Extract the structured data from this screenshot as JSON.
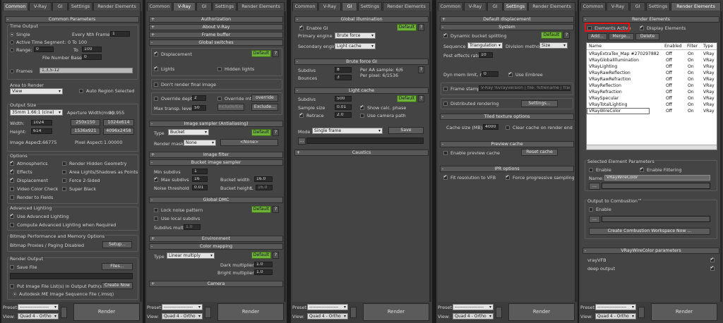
{
  "tabs": {
    "common": "Common",
    "vray": "V-Ray",
    "gi": "GI",
    "settings": "Settings",
    "render_elements": "Render Elements"
  },
  "preset_label": "Preset:",
  "view_label": "View:",
  "preset_value": "-------------------",
  "view_value": "Quad 4 - Ortho",
  "render_label": "Render",
  "p1": {
    "common_params": "Common Parameters",
    "time_output": "Time Output",
    "single": "Single",
    "every_nth": "Every Nth Frame:",
    "every_nth_val": "1",
    "active_seg": "Active Time Segment:",
    "active_seg_range": "0 To 100",
    "range": "Range:",
    "range_from": "0",
    "range_to": "To",
    "range_end": "100",
    "file_number_base": "File Number Base:",
    "file_number_val": "0",
    "frames": "Frames",
    "frames_val": "1,3,5-12",
    "area_to_render": "Area to Render",
    "area_dd": "View",
    "auto_region": "Auto Region Selected",
    "output_size": "Output Size",
    "size_dd": "35mm 1.66:1 (cine)",
    "aperture": "Aperture Width(mm):",
    "aperture_val": "20.955",
    "width": "Width:",
    "width_val": "1024",
    "height": "Height:",
    "height_val": "614",
    "preset_a": "250x150",
    "preset_b": "1024x614",
    "preset_c": "1536x921",
    "preset_d": "4096x2458",
    "image_aspect": "Image Aspect:",
    "image_aspect_val": "1.66775",
    "pixel_aspect": "Pixel Aspect:",
    "pixel_aspect_val": "1.00000",
    "options": "Options",
    "atmospherics": "Atmospherics",
    "render_hidden": "Render Hidden Geometry",
    "effects": "Effects",
    "area_lights": "Area Lights/Shadows as Points",
    "displacement": "Displacement",
    "force_2sided": "Force 2-Sided",
    "video_color": "Video Color Check",
    "super_black": "Super Black",
    "render_fields": "Render to Fields",
    "adv_lighting": "Advanced Lighting",
    "use_adv": "Use Advanced Lighting",
    "compute_adv": "Compute Advanced Lighting when Required",
    "bitmap_perf": "Bitmap Performance and Memory Options",
    "bitmap_proxies": "Bitmap Proxies / Paging Disabled",
    "setup": "Setup...",
    "render_output": "Render Output",
    "save_file": "Save File",
    "files": "Files...",
    "put_image": "Put Image File List(s) in Output Path(s)",
    "create_now": "Create Now",
    "autodesk": "Autodesk ME Image Sequence File (.imsq)"
  },
  "p2": {
    "authorization": "Authorization",
    "about": "About V-Ray",
    "frame_buffer": "Frame buffer",
    "global_switches": "Global switches",
    "displacement": "Displacement",
    "default": "Default",
    "q": "?",
    "lights": "Lights",
    "hidden_lights": "Hidden lights",
    "dont_render": "Don't render final image",
    "override_depth": "Override depth",
    "override_depth_val": "2",
    "override_mtl": "Override mtl",
    "override": "override",
    "max_transp": "Max transp. levels",
    "max_transp_val": "50",
    "include_exc": "Include/Exc",
    "exclude": "Exclude...",
    "image_sampler": "Image sampler (Antialiasing)",
    "type": "Type",
    "type_val": "Bucket",
    "render_mask": "Render mask",
    "render_mask_val": "None",
    "none_btn": "<None>",
    "image_filter": "Image filter",
    "bucket_sampler": "Bucket image sampler",
    "min_subdivs": "Min subdivs",
    "min_subdivs_val": "1",
    "max_subdivs": "Max subdivs",
    "max_subdivs_val": "16",
    "bucket_width": "Bucket width",
    "bucket_width_val": "16.0",
    "noise_thresh": "Noise threshold",
    "noise_thresh_val": "0.01",
    "bucket_height": "Bucket height",
    "bucket_l": "L",
    "bucket_height_val": "16.0",
    "global_dmc": "Global DMC",
    "lock_noise": "Lock noise pattern",
    "use_local": "Use local subdivs",
    "subdivs_mult": "Subdivs mult.",
    "subdivs_mult_val": "1.0",
    "environment": "Environment",
    "color_mapping": "Color mapping",
    "cm_type_val": "Linear multiply",
    "dark_mult": "Dark multiplier:",
    "dark_mult_val": "1.0",
    "bright_mult": "Bright multiplier:",
    "bright_mult_val": "1.0",
    "camera": "Camera"
  },
  "p3": {
    "gi": "Global illumination",
    "enable_gi": "Enable GI",
    "default": "Default",
    "q": "?",
    "primary": "Primary engine",
    "primary_val": "Brute force",
    "secondary": "Secondary engine",
    "secondary_val": "Light cache",
    "brute_gi": "Brute force GI",
    "subdivs": "Subdivs",
    "subdivs_val": "8",
    "per_aa": "Per AA sample: 6/6",
    "bounces": "Bounces",
    "bounces_val": "3",
    "per_pixel": "Per pixel: 6/1536",
    "light_cache": "Light cache",
    "lc_subdivs_val": "500",
    "sample_size": "Sample size",
    "sample_size_val": "0.01",
    "show_calc": "Show calc. phase",
    "retrace": "Retrace",
    "retrace_val": "2.0",
    "use_cam": "Use camera path",
    "mode": "Mode",
    "mode_val": "Single frame",
    "save": "Save",
    "dots": "...",
    "caustics": "Caustics"
  },
  "p4": {
    "default_disp": "Default displacement",
    "system": "System",
    "dyn_bucket": "Dynamic bucket splitting",
    "default": "Default",
    "q": "?",
    "sequence": "Sequence",
    "sequence_val": "Triangulation",
    "div_method": "Division method",
    "div_val": "Size",
    "post_effects": "Post effects rate",
    "post_effects_val": "10",
    "dyn_mem": "Dyn mem limit, mb",
    "dyn_mem_val": "0",
    "use_embree": "Use Embree",
    "frame_stamp": "Frame stamp",
    "stamp_val": "V-Ray %vrayversion | file: %filename | fram",
    "distributed": "Distributed rendering",
    "settings_btn": "Settings...",
    "tiled": "Tiled texture options",
    "cache_size": "Cache size (MB):",
    "cache_val": "4000",
    "clear_cache": "Clear cache on render end",
    "preview_cache": "Preview cache",
    "enable_preview": "Enable preview cache",
    "reset_cache": "Reset cache",
    "ipr": "IPR options",
    "fit_vfb": "Fit resolution to VFB",
    "force_prog": "Force progressive sampling"
  },
  "p5": {
    "render_elements": "Render Elements",
    "elements_active": "Elements Active",
    "display_elements": "Display Elements",
    "add": "Add...",
    "merge": "Merge...",
    "delete": "Delete",
    "col_name": "Name",
    "col_enabled": "Enabled",
    "col_filter": "Filter",
    "col_type": "Type",
    "rows": [
      {
        "name": "VRayExtraTex_Map #270297882",
        "enabled": "Off",
        "filter": "On",
        "type": "VRay"
      },
      {
        "name": "VRayGlobalIllumination",
        "enabled": "Off",
        "filter": "On",
        "type": "VRay"
      },
      {
        "name": "VRayLighting",
        "enabled": "Off",
        "filter": "On",
        "type": "VRay"
      },
      {
        "name": "VRayRawReflection",
        "enabled": "Off",
        "filter": "On",
        "type": "VRay"
      },
      {
        "name": "VRayRawRefraction",
        "enabled": "Off",
        "filter": "On",
        "type": "VRay"
      },
      {
        "name": "VRayReflection",
        "enabled": "Off",
        "filter": "On",
        "type": "VRay"
      },
      {
        "name": "VRayRefraction",
        "enabled": "Off",
        "filter": "On",
        "type": "VRay"
      },
      {
        "name": "VRaySpecular",
        "enabled": "Off",
        "filter": "On",
        "type": "VRay"
      },
      {
        "name": "VRayTotalLighting",
        "enabled": "Off",
        "filter": "On",
        "type": "VRay"
      },
      {
        "name": "VRayWireColor",
        "enabled": "Off",
        "filter": "On",
        "type": "VRay"
      }
    ],
    "selected_params": "Selected Element Parameters",
    "enable": "Enable",
    "enable_filtering": "Enable Filtering",
    "name_label": "Name:",
    "name_val": "VRayWireColor",
    "dots": "...",
    "output_comb": "Output to Combustion™",
    "create_ws": "Create Combustion Workspace Now ...",
    "wire_params": "VRayWireColor parameters",
    "vrayvfb": "vrayVFB",
    "deep_output": "deep output"
  }
}
